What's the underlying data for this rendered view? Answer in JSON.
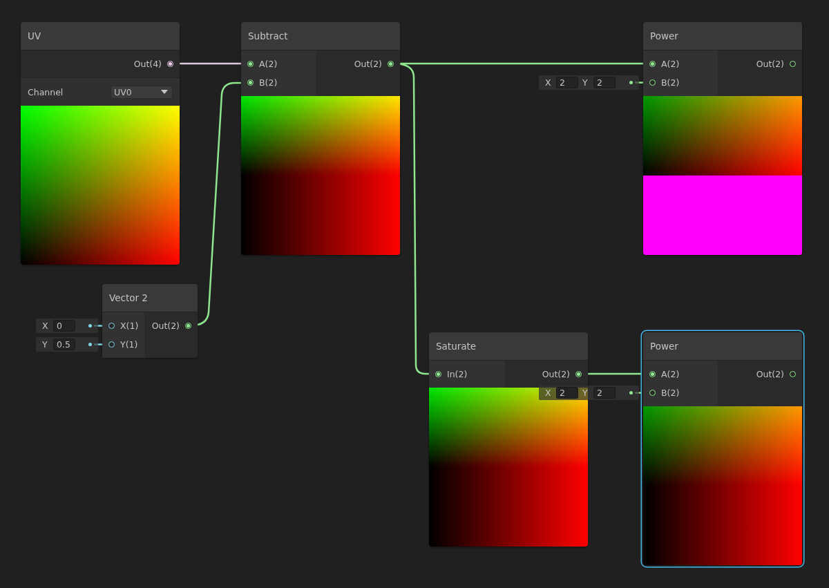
{
  "nodes": [
    {
      "title": "UV",
      "selected": false,
      "outputs": [
        {
          "label": "Out(4)",
          "kind": "vector4",
          "connected": true
        }
      ],
      "control": {
        "label": "Channel",
        "value": "UV0"
      },
      "preview": {
        "kind": "uv"
      }
    },
    {
      "title": "Subtract",
      "selected": false,
      "inputs": [
        {
          "label": "A(2)",
          "kind": "vector2",
          "connected": true
        },
        {
          "label": "B(2)",
          "kind": "vector2",
          "connected": true
        }
      ],
      "outputs": [
        {
          "label": "Out(2)",
          "kind": "vector2",
          "connected": true
        }
      ],
      "preview": {
        "kind": "split"
      }
    },
    {
      "title": "Power",
      "selected": false,
      "inputs": [
        {
          "label": "A(2)",
          "kind": "vector2",
          "connected": true
        },
        {
          "label": "B(2)",
          "kind": "vector2",
          "connected": false,
          "fields": [
            {
              "axis": "X",
              "value": "2"
            },
            {
              "axis": "Y",
              "value": "2"
            }
          ]
        }
      ],
      "outputs": [
        {
          "label": "Out(2)",
          "kind": "vector2",
          "connected": false
        }
      ],
      "preview": {
        "kind": "nan"
      }
    },
    {
      "title": "Vector 2",
      "selected": false,
      "inputs": [
        {
          "label": "X(1)",
          "kind": "vector1",
          "connected": false,
          "fields": [
            {
              "axis": "X",
              "value": "0"
            }
          ]
        },
        {
          "label": "Y(1)",
          "kind": "vector1",
          "connected": false,
          "fields": [
            {
              "axis": "Y",
              "value": "0.5"
            }
          ]
        }
      ],
      "outputs": [
        {
          "label": "Out(2)",
          "kind": "vector2",
          "connected": true
        }
      ]
    },
    {
      "title": "Saturate",
      "selected": false,
      "inputs": [
        {
          "label": "In(2)",
          "kind": "vector2",
          "connected": true
        }
      ],
      "outputs": [
        {
          "label": "Out(2)",
          "kind": "vector2",
          "connected": true
        }
      ],
      "preview": {
        "kind": "split"
      }
    },
    {
      "title": "Power",
      "selected": true,
      "inputs": [
        {
          "label": "A(2)",
          "kind": "vector2",
          "connected": true
        },
        {
          "label": "B(2)",
          "kind": "vector2",
          "connected": false,
          "fields": [
            {
              "axis": "X",
              "value": "2"
            },
            {
              "axis": "Y",
              "value": "2"
            }
          ]
        }
      ],
      "outputs": [
        {
          "label": "Out(2)",
          "kind": "vector2",
          "connected": false
        }
      ],
      "preview": {
        "kind": "dark"
      }
    }
  ]
}
